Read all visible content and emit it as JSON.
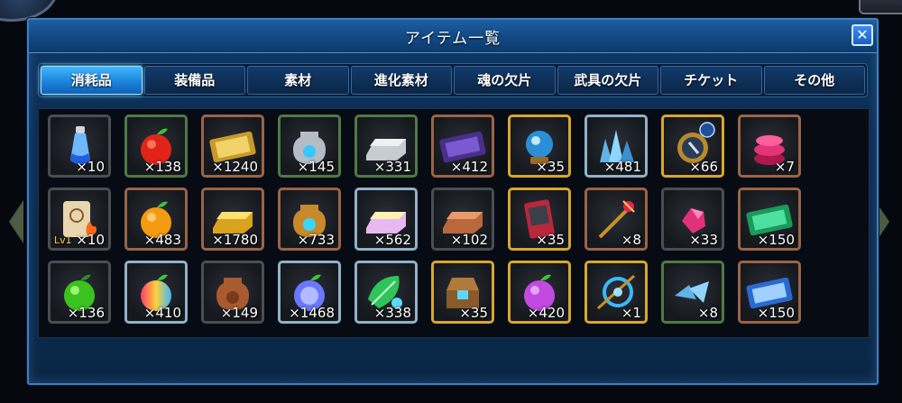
{
  "window": {
    "title": "アイテム一覧",
    "close_label": "✕"
  },
  "tabs": [
    {
      "label": "消耗品",
      "active": true
    },
    {
      "label": "装備品",
      "active": false
    },
    {
      "label": "素材",
      "active": false
    },
    {
      "label": "進化素材",
      "active": false
    },
    {
      "label": "魂の欠片",
      "active": false
    },
    {
      "label": "武具の欠片",
      "active": false
    },
    {
      "label": "チケット",
      "active": false
    },
    {
      "label": "その他",
      "active": false
    }
  ],
  "items": [
    {
      "icon": "potion-bottle-icon",
      "qty": "×10"
    },
    {
      "icon": "red-apple-icon",
      "qty": "×138"
    },
    {
      "icon": "gold-ticket-icon",
      "qty": "×1240"
    },
    {
      "icon": "silver-jug-icon",
      "qty": "×145"
    },
    {
      "icon": "silver-ingot-icon",
      "qty": "×331"
    },
    {
      "icon": "purple-ticket-icon",
      "qty": "×412"
    },
    {
      "icon": "crystal-orb-icon",
      "qty": "×35"
    },
    {
      "icon": "blue-crystals-icon",
      "qty": "×481"
    },
    {
      "icon": "mirror-clock-icon",
      "qty": "×66"
    },
    {
      "icon": "pink-stones-icon",
      "qty": "×7"
    },
    {
      "icon": "scroll-fire-icon",
      "qty": "×10",
      "level": "Lv1"
    },
    {
      "icon": "orange-apple-icon",
      "qty": "×483"
    },
    {
      "icon": "gold-ingot-icon",
      "qty": "×1780"
    },
    {
      "icon": "gold-jug-icon",
      "qty": "×733"
    },
    {
      "icon": "rainbow-ingot-icon",
      "qty": "×562"
    },
    {
      "icon": "copper-ingot-icon",
      "qty": "×102"
    },
    {
      "icon": "red-card-icon",
      "qty": "×35"
    },
    {
      "icon": "magic-staff-icon",
      "qty": "×8"
    },
    {
      "icon": "pink-gem-icon",
      "qty": "×33"
    },
    {
      "icon": "green-event-ticket-icon",
      "qty": "×150"
    },
    {
      "icon": "green-apple-icon",
      "qty": "×136"
    },
    {
      "icon": "rainbow-apple-icon",
      "qty": "×410"
    },
    {
      "icon": "copper-jug-icon",
      "qty": "×149"
    },
    {
      "icon": "blue-glow-apple-icon",
      "qty": "×1468"
    },
    {
      "icon": "green-leaf-icon",
      "qty": "×338"
    },
    {
      "icon": "treasure-chest-icon",
      "qty": "×35"
    },
    {
      "icon": "purple-apple-icon",
      "qty": "×420"
    },
    {
      "icon": "blue-compass-icon",
      "qty": "×1"
    },
    {
      "icon": "blue-shards-icon",
      "qty": "×8"
    },
    {
      "icon": "blue-ticket-icon",
      "qty": "×150"
    }
  ],
  "colors": {
    "accent": "#1b84dc",
    "panel": "#0b2c52"
  }
}
